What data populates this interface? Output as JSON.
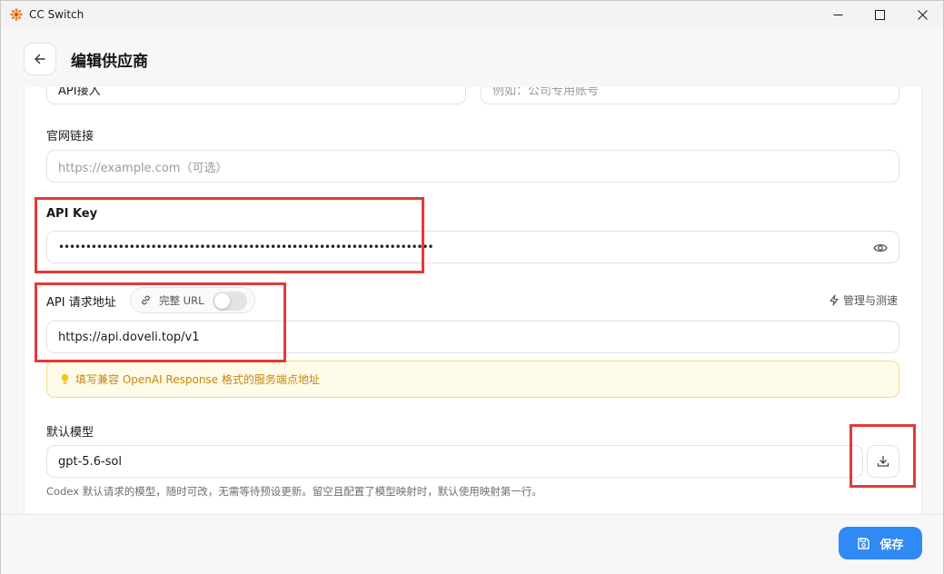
{
  "window": {
    "title": "CC Switch"
  },
  "header": {
    "title": "编辑供应商"
  },
  "form": {
    "top_left_value": "API接入",
    "top_right_placeholder": "例如：公司专用账号",
    "website": {
      "label": "官网链接",
      "placeholder": "https://example.com（可选）"
    },
    "api_key": {
      "label": "API Key",
      "masked_value": "•••••••••••••••••••••••••••••••••••••••••••••••••••••••••••••••••••••"
    },
    "endpoint": {
      "label": "API 请求地址",
      "toggle_label": "完整 URL",
      "toggle_on": false,
      "manage_label": "管理与测速",
      "value": "https://api.doveli.top/v1",
      "hint": "填写兼容 OpenAI Response 格式的服务端点地址"
    },
    "model": {
      "label": "默认模型",
      "value": "gpt-5.6-sol",
      "help": "Codex 默认请求的模型，随时可改，无需等待预设更新。留空且配置了模型映射时，默认使用映射第一行。"
    }
  },
  "footer": {
    "save_label": "保存"
  },
  "colors": {
    "accent": "#2f8af5",
    "annotation": "#e53935",
    "hint_text": "#c7870f",
    "hint_bg": "#fefbe8"
  },
  "icons": [
    "app-logo-icon",
    "minimize-icon",
    "maximize-icon",
    "close-icon",
    "arrow-left-icon",
    "eye-icon",
    "link-icon",
    "lightning-icon",
    "lightbulb-icon",
    "download-icon",
    "save-icon"
  ]
}
